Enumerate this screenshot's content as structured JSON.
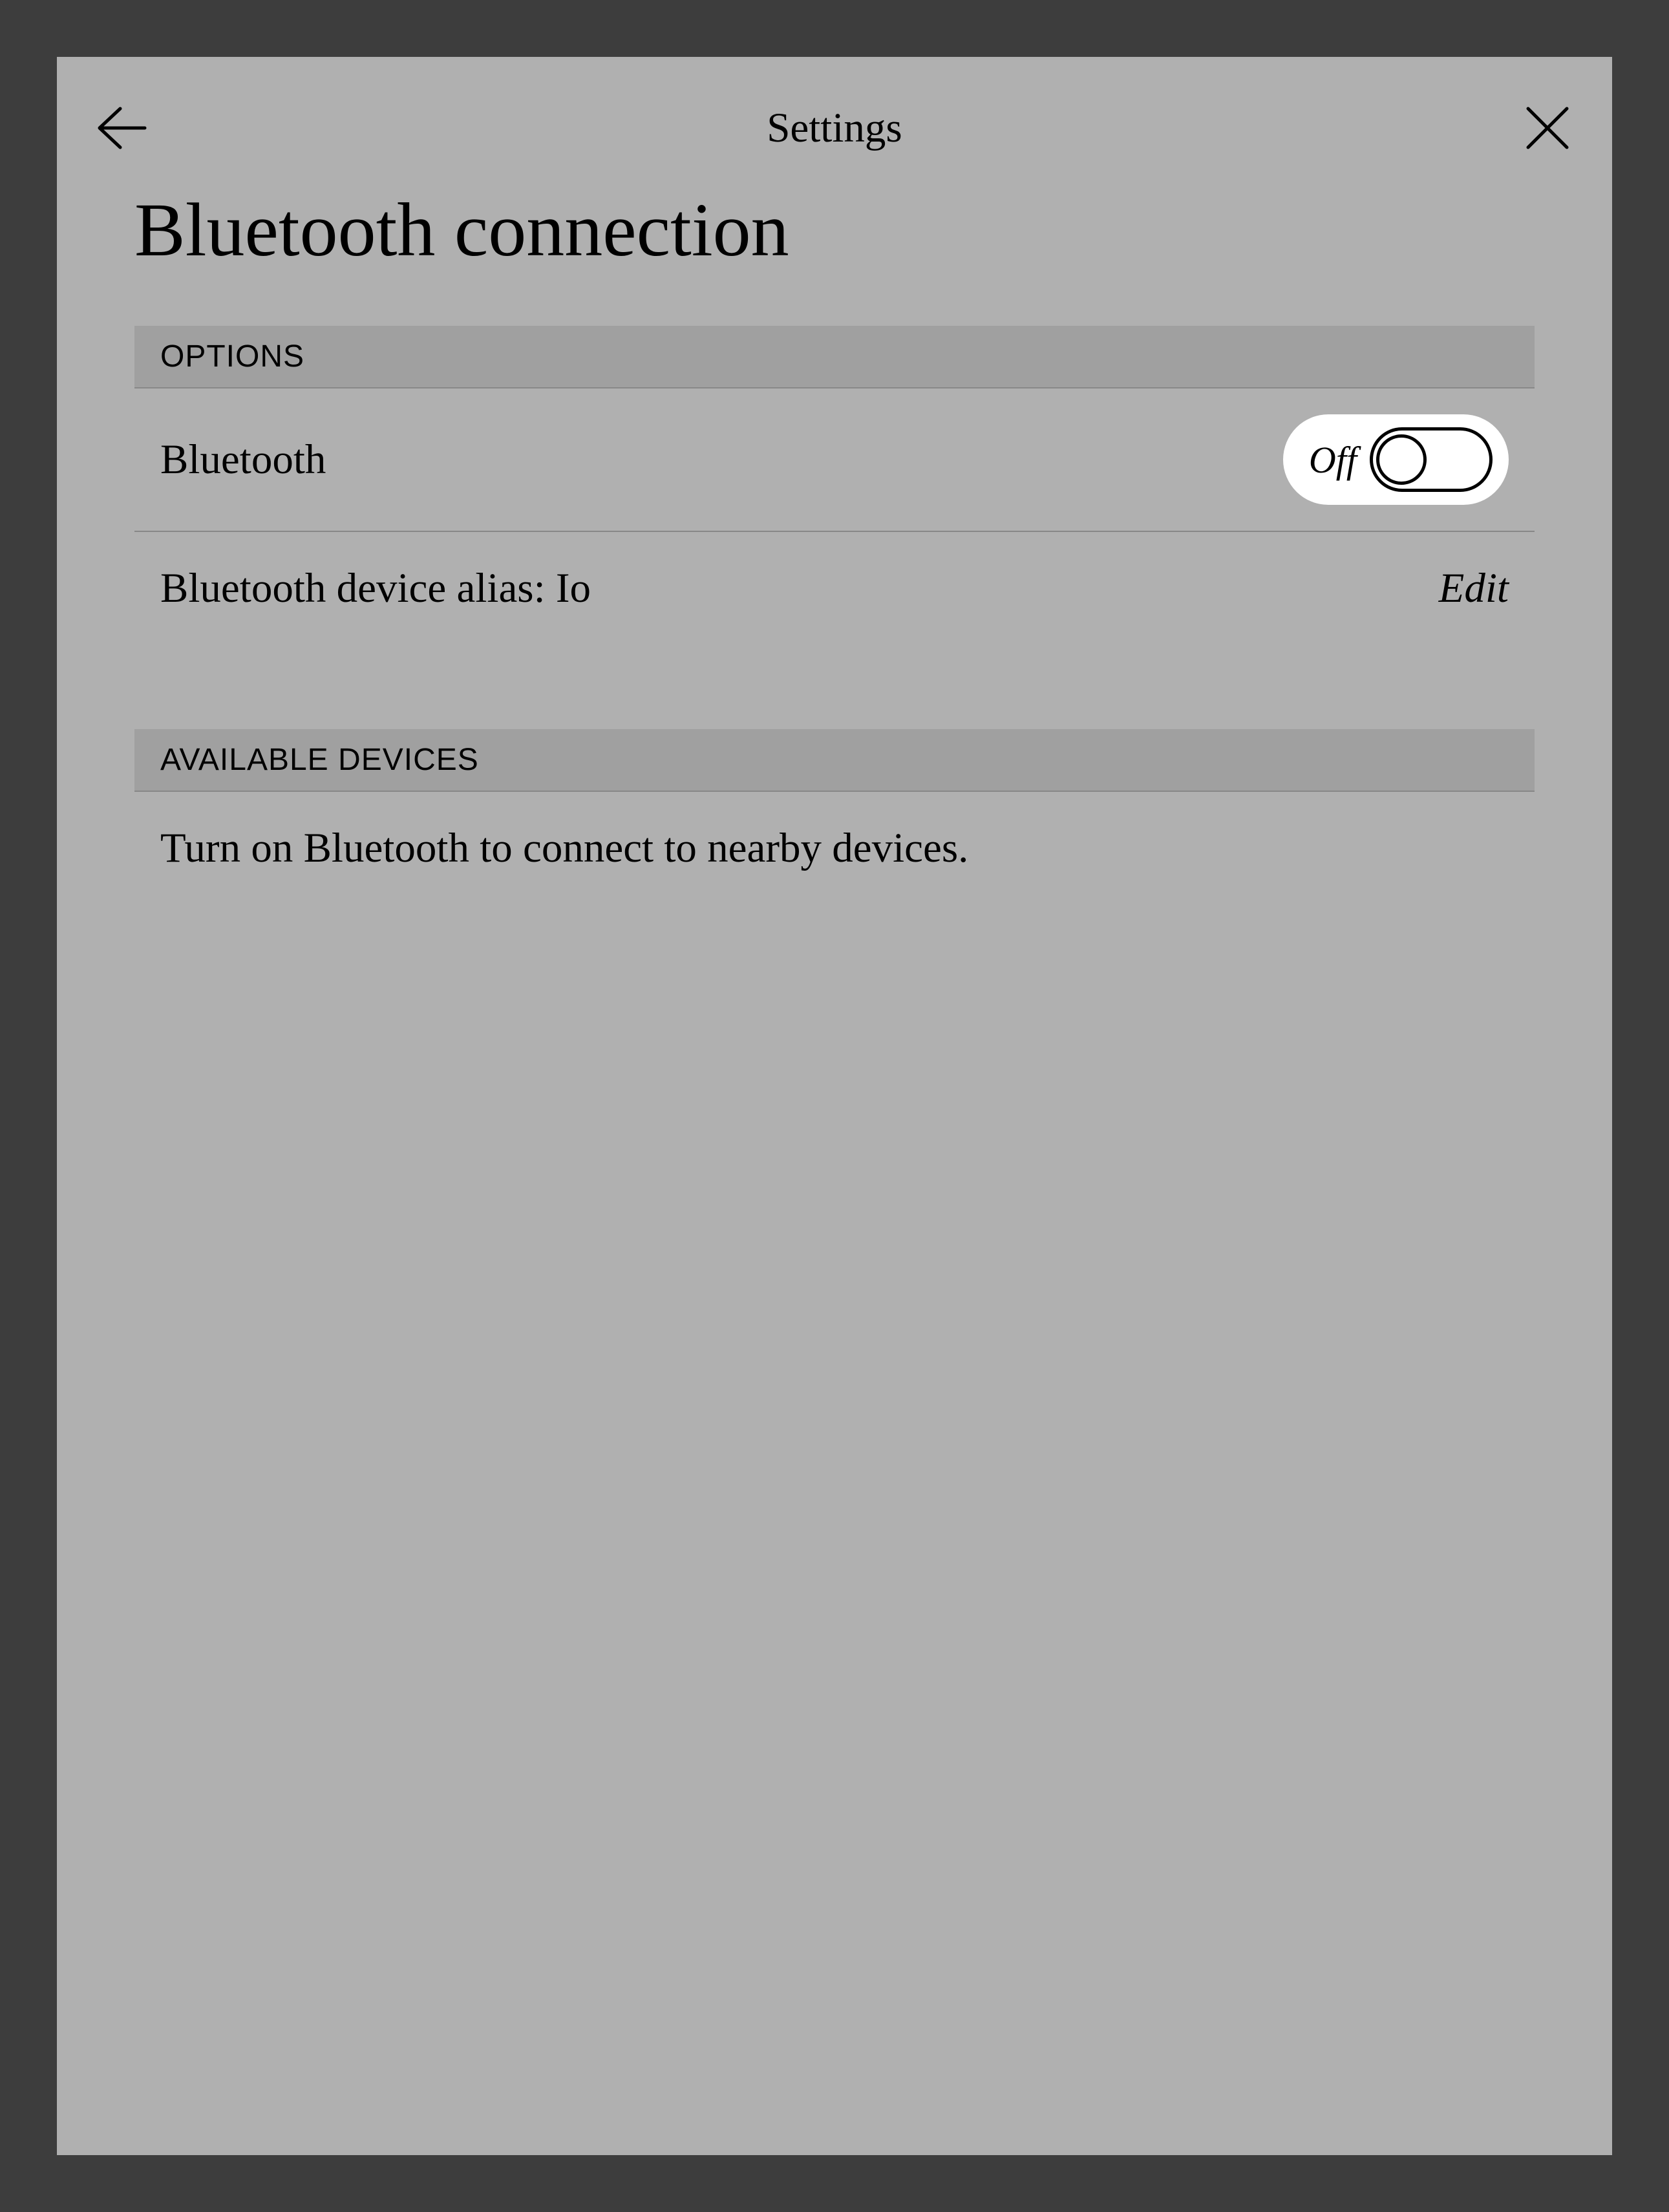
{
  "header": {
    "title": "Settings"
  },
  "page": {
    "title": "Bluetooth connection"
  },
  "sections": {
    "options": {
      "header": "OPTIONS",
      "bluetooth_label": "Bluetooth",
      "toggle_state": "Off",
      "alias_label": "Bluetooth device alias: Io",
      "edit_label": "Edit"
    },
    "available": {
      "header": "AVAILABLE DEVICES",
      "hint": "Turn on Bluetooth to connect to nearby devices."
    }
  }
}
